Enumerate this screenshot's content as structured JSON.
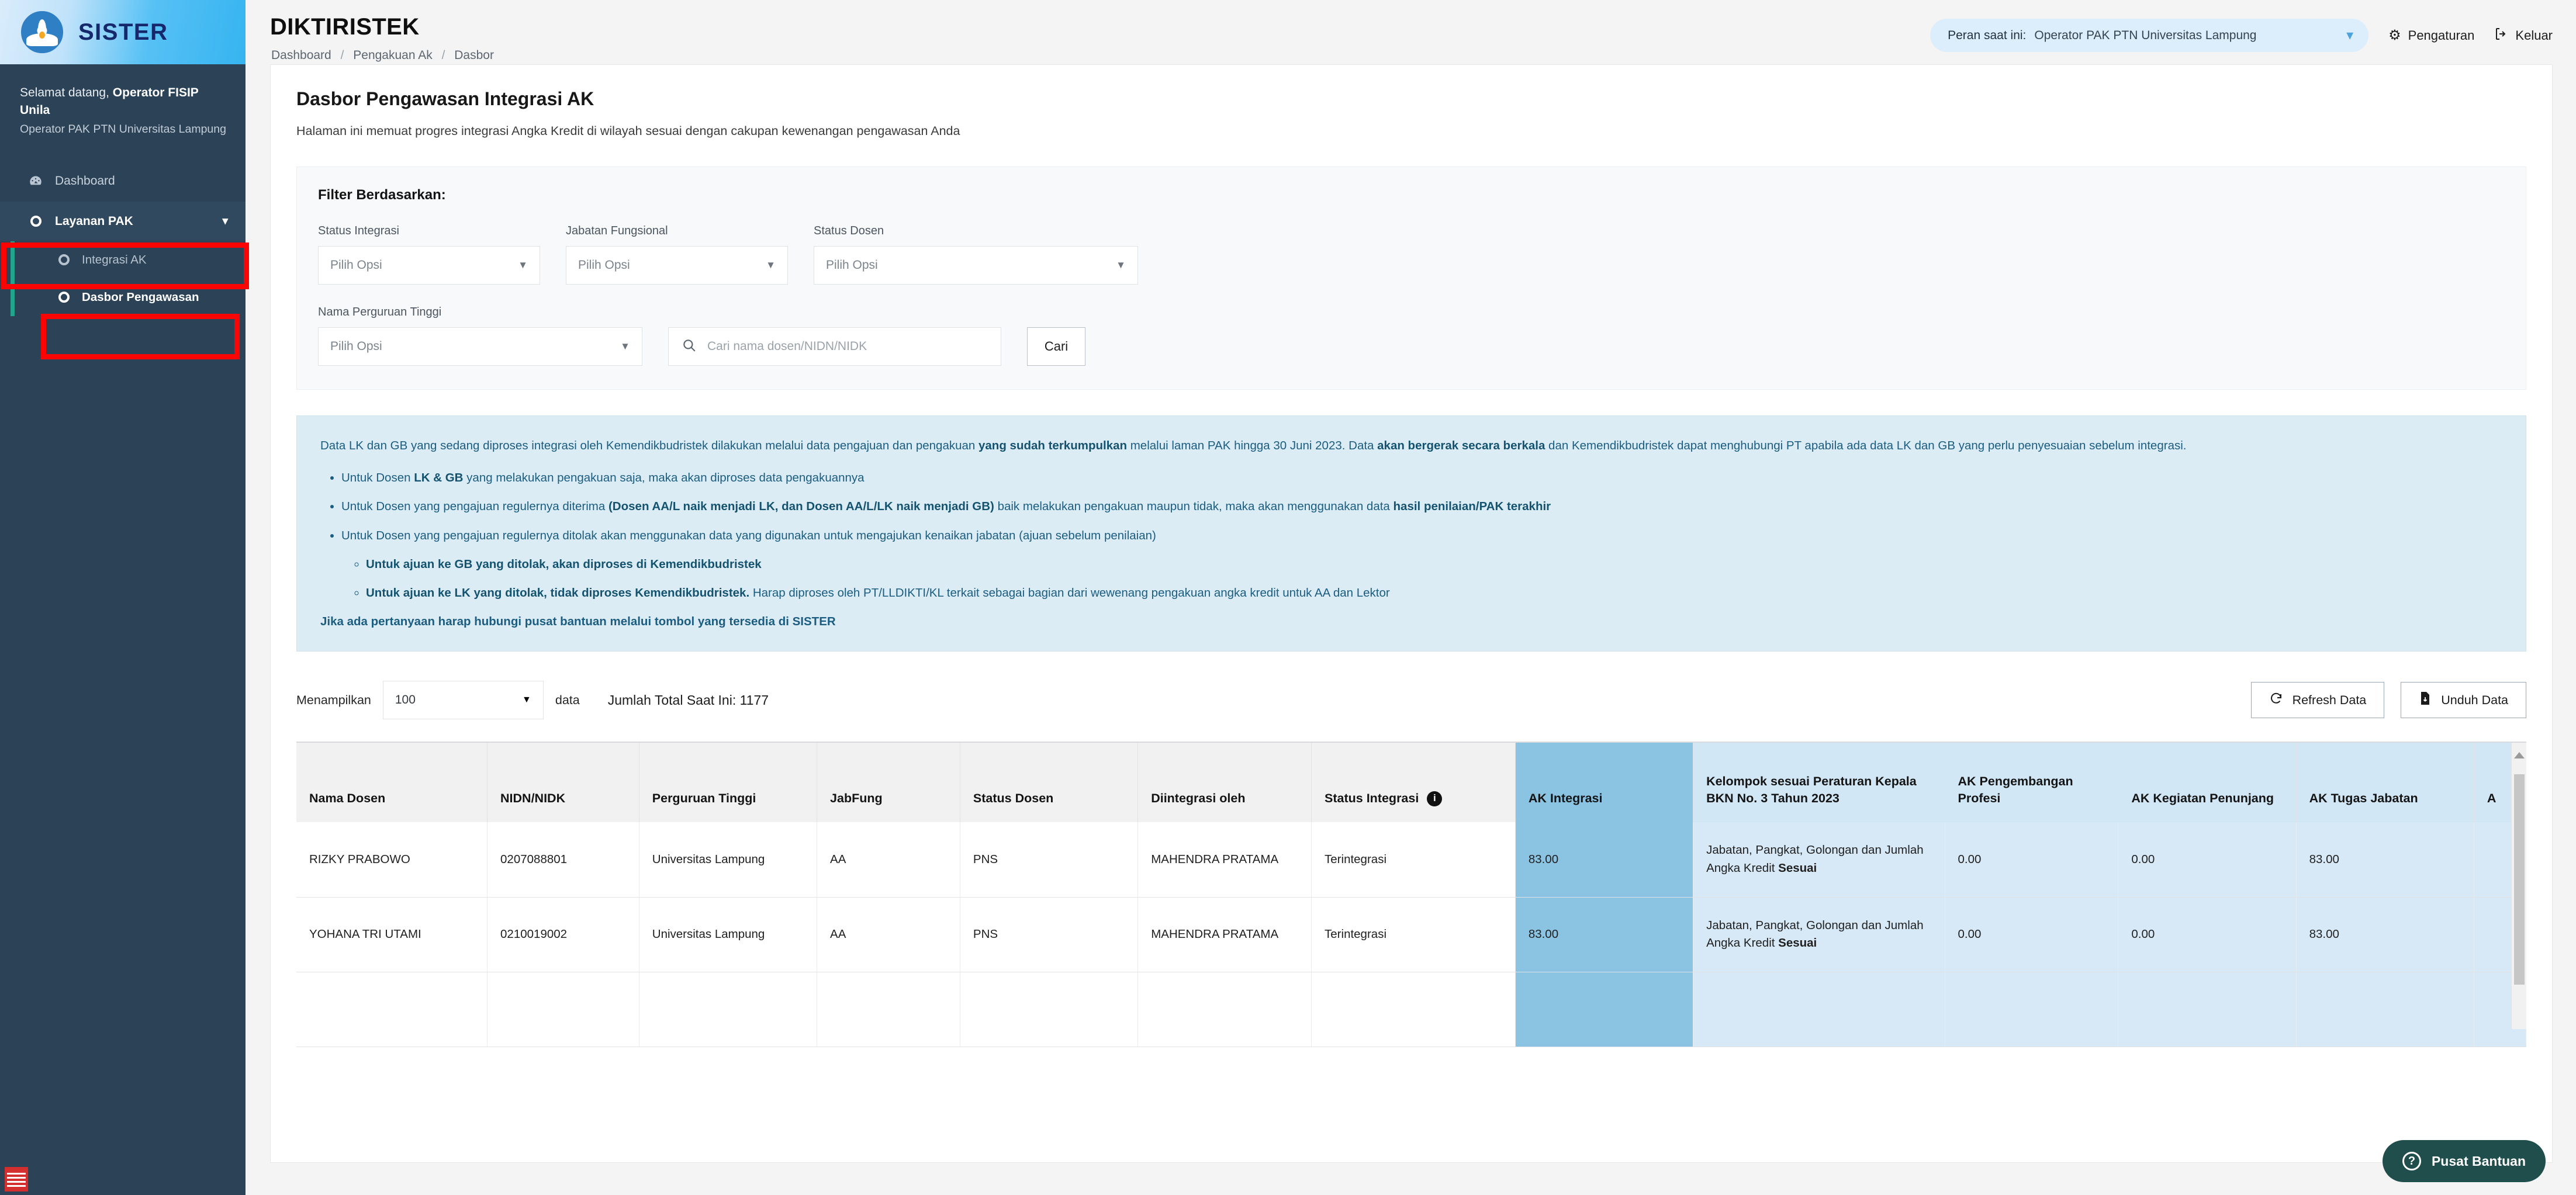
{
  "sidebar": {
    "brand_name": "SISTER",
    "brand_logo_icon": "tutwuri-handayani-logo",
    "welcome_prefix": "Selamat datang,",
    "welcome_user": "Operator FISIP Unila",
    "welcome_role": "Operator PAK PTN Universitas Lampung",
    "items": [
      {
        "label": "Dashboard",
        "icon": "speedometer-icon"
      },
      {
        "label": "Layanan PAK",
        "icon": "circle-o-icon",
        "chevron": "chevron-down-icon"
      }
    ],
    "subitems": [
      {
        "label": "Integrasi AK",
        "icon": "circle-o-icon"
      },
      {
        "label": "Dasbor Pengawasan",
        "icon": "circle-o-icon"
      }
    ]
  },
  "topbar": {
    "app_title": "DIKTIRISTEK",
    "breadcrumb": [
      "Dashboard",
      "Pengakuan Ak",
      "Dasbor"
    ],
    "role_label": "Peran saat ini:",
    "role_value": "Operator PAK PTN Universitas Lampung",
    "settings_label": "Pengaturan",
    "logout_label": "Keluar",
    "settings_icon": "gear-icon",
    "logout_icon": "exit-icon"
  },
  "page": {
    "title": "Dasbor Pengawasan Integrasi AK",
    "description": "Halaman ini memuat progres integrasi Angka Kredit di wilayah sesuai dengan cakupan kewenangan pengawasan Anda"
  },
  "filter": {
    "title": "Filter Berdasarkan:",
    "fields": [
      {
        "label": "Status Integrasi",
        "value": "Pilih Opsi"
      },
      {
        "label": "Jabatan Fungsional",
        "value": "Pilih Opsi"
      },
      {
        "label": "Status Dosen",
        "value": "Pilih Opsi"
      },
      {
        "label": "Nama Perguruan Tinggi",
        "value": "Pilih Opsi"
      }
    ],
    "search_placeholder": "Cari nama dosen/NIDN/NIDK",
    "search_value": "",
    "search_icon": "search-icon",
    "search_button": "Cari"
  },
  "alert": {
    "paragraph_parts": [
      "Data LK dan GB yang sedang diproses integrasi oleh Kemendikbudristek dilakukan melalui data pengajuan dan pengakuan ",
      "yang sudah terkumpulkan",
      " melalui laman PAK hingga 30 Juni 2023. Data ",
      "akan bergerak secara berkala",
      " dan Kemendikbudristek dapat menghubungi PT apabila ada data LK dan GB yang perlu penyesuaian sebelum integrasi."
    ],
    "bullets": [
      {
        "parts": [
          "Untuk Dosen ",
          "LK & GB",
          " yang melakukan pengakuan saja, maka akan diproses data pengakuannya"
        ],
        "bold_index": 1
      },
      {
        "parts": [
          "Untuk Dosen yang pengajuan regulernya diterima ",
          "(Dosen AA/L naik menjadi LK, dan Dosen AA/L/LK naik menjadi GB)",
          " baik melakukan pengakuan maupun tidak, maka akan menggunakan data ",
          "hasil penilaian/PAK terakhir"
        ],
        "bold_index": 1
      },
      {
        "parts": [
          "Untuk Dosen yang pengajuan regulernya ditolak akan menggunakan data yang digunakan untuk mengajukan kenaikan jabatan (ajuan sebelum penilaian)"
        ],
        "bold_index": -1
      }
    ],
    "subbullets": [
      "Untuk ajuan ke GB yang ditolak, akan diproses di Kemendikbudristek",
      "Untuk ajuan ke LK yang ditolak, tidak diproses Kemendikbudristek. Harap diproses oleh PT/LLDIKTI/KL terkait sebagai bagian dari wewenang pengakuan angka kredit untuk AA dan Lektor"
    ],
    "subbullet_bold": [
      "Untuk ajuan ke GB yang ditolak, akan diproses di Kemendikbudristek",
      "Untuk ajuan ke LK yang ditolak, tidak diproses Kemendikbudristek."
    ],
    "subbullet_rest": [
      "",
      " Harap diproses oleh PT/LLDIKTI/KL terkait sebagai bagian dari wewenang pengakuan angka kredit untuk AA dan Lektor"
    ],
    "tail": "Jika ada pertanyaan harap hubungi pusat bantuan melalui tombol yang tersedia di SISTER"
  },
  "table_controls": {
    "show_label": "Menampilkan",
    "show_value": "100",
    "data_word": "data",
    "total_text": "Jumlah Total Saat Ini: 1177",
    "refresh_label": "Refresh Data",
    "refresh_icon": "refresh-icon",
    "download_label": "Unduh Data",
    "download_icon": "file-download-icon"
  },
  "table": {
    "columns": [
      "Nama Dosen",
      "NIDN/NIDK",
      "Perguruan Tinggi",
      "JabFung",
      "Status Dosen",
      "Diintegrasi oleh",
      "Status Integrasi",
      "AK Integrasi",
      "Kelompok sesuai Peraturan Kepala BKN No. 3 Tahun 2023",
      "AK Pengembangan Profesi",
      "AK Kegiatan Penunjang",
      "AK Tugas Jabatan",
      "A"
    ],
    "status_integrasi_info_icon": "info-icon",
    "rows": [
      {
        "nama": "RIZKY PRABOWO",
        "nidn": "0207088801",
        "pt": "Universitas Lampung",
        "jabfung": "AA",
        "status_dosen": "PNS",
        "diintegrasi": "MAHENDRA PRATAMA",
        "status_integrasi": "Terintegrasi",
        "ak_integrasi": "83.00",
        "kelompok_prefix": "Jabatan, Pangkat, Golongan dan Jumlah Angka Kredit ",
        "kelompok_bold": "Sesuai",
        "ak_pengembangan": "0.00",
        "ak_penunjang": "0.00",
        "ak_tugas": "83.00"
      },
      {
        "nama": "YOHANA TRI UTAMI",
        "nidn": "0210019002",
        "pt": "Universitas Lampung",
        "jabfung": "AA",
        "status_dosen": "PNS",
        "diintegrasi": "MAHENDRA PRATAMA",
        "status_integrasi": "Terintegrasi",
        "ak_integrasi": "83.00",
        "kelompok_prefix": "Jabatan, Pangkat, Golongan dan Jumlah Angka Kredit ",
        "kelompok_bold": "Sesuai",
        "ak_pengembangan": "0.00",
        "ak_penunjang": "0.00",
        "ak_tugas": "83.00"
      },
      {
        "nama": "",
        "nidn": "",
        "pt": "",
        "jabfung": "",
        "status_dosen": "",
        "diintegrasi": "",
        "status_integrasi": "",
        "ak_integrasi": "",
        "kelompok_prefix": "",
        "kelompok_bold": "",
        "ak_pengembangan": "",
        "ak_penunjang": "",
        "ak_tugas": ""
      }
    ]
  },
  "help": {
    "label": "Pusat Bantuan",
    "icon": "question-circle-icon"
  },
  "colors": {
    "sidebar_bg": "#2b4257",
    "brand_text": "#14286b",
    "accent_teal": "#23a58d",
    "highlight_strong": "#8bc3e3",
    "highlight_soft": "#d2e7f5",
    "alert_bg": "#dcecf5",
    "alert_text": "#1a5d80",
    "annotation_red": "#fb0404",
    "help_bg": "#1f4e4d"
  }
}
